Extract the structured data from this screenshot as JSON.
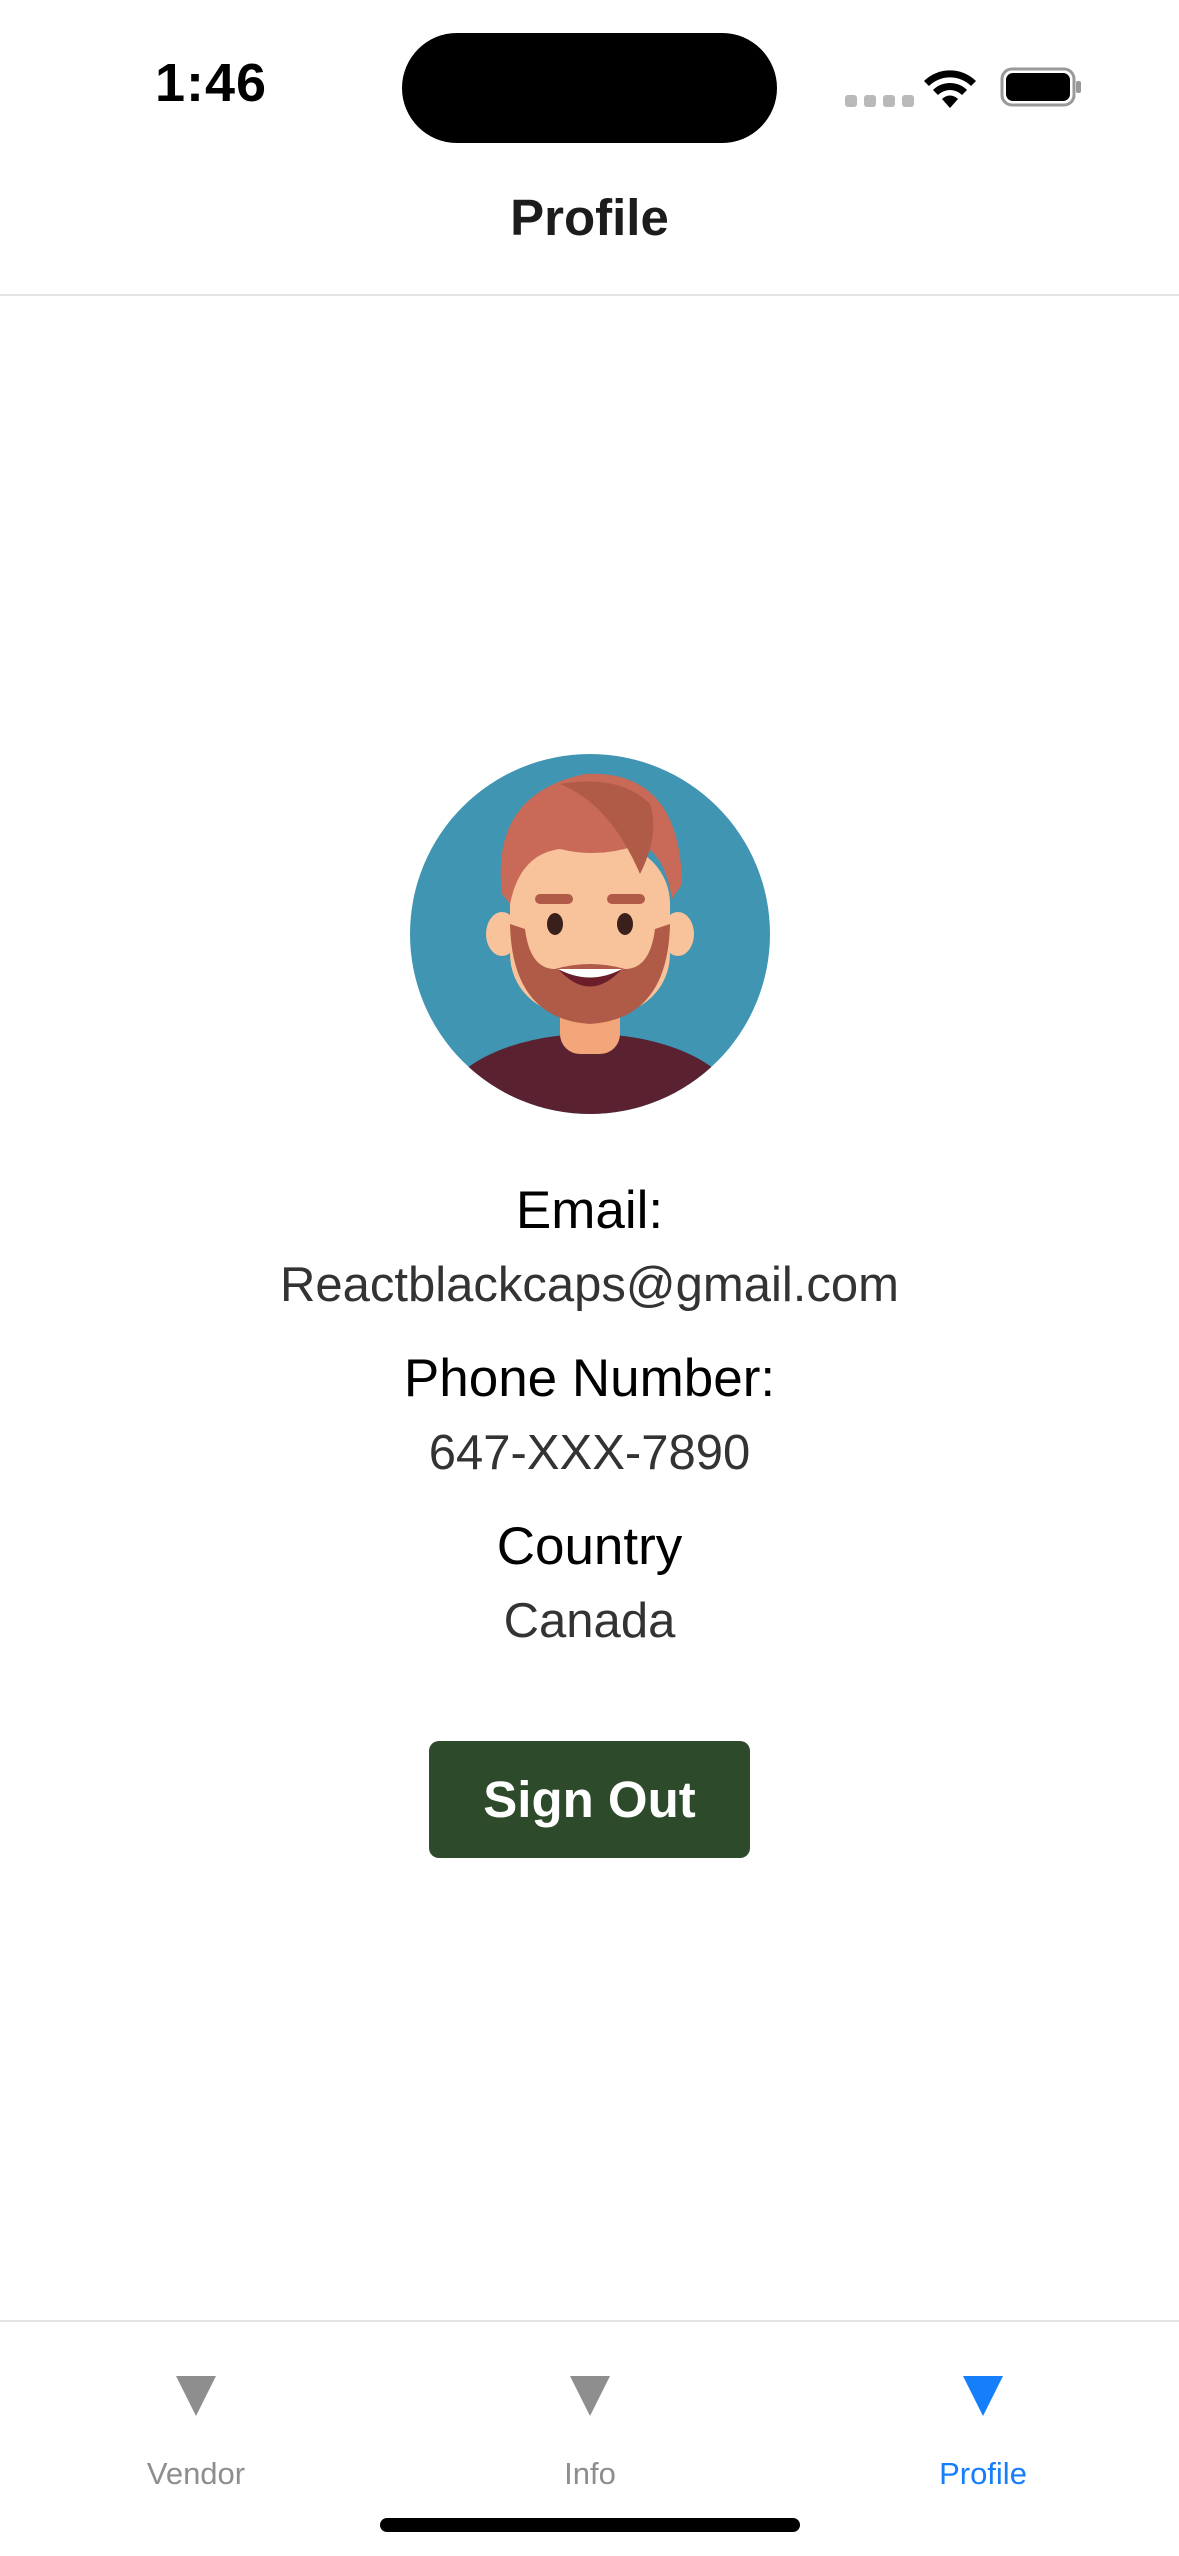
{
  "status_bar": {
    "time": "1:46"
  },
  "header": {
    "title": "Profile"
  },
  "profile": {
    "email_label": "Email:",
    "email_value": "Reactblackcaps@gmail.com",
    "phone_label": "Phone Number:",
    "phone_value": "647-XXX-7890",
    "country_label": "Country",
    "country_value": "Canada",
    "signout_label": "Sign Out"
  },
  "tabs": [
    {
      "label": "Vendor",
      "icon": "triangle-down-icon",
      "active": false
    },
    {
      "label": "Info",
      "icon": "triangle-down-icon",
      "active": false
    },
    {
      "label": "Profile",
      "icon": "triangle-down-icon",
      "active": true
    }
  ],
  "colors": {
    "accent": "#147efb",
    "signout_button": "#2d4a2b",
    "inactive_tab": "#8e8e8e",
    "avatar_background": "#4095b3"
  }
}
